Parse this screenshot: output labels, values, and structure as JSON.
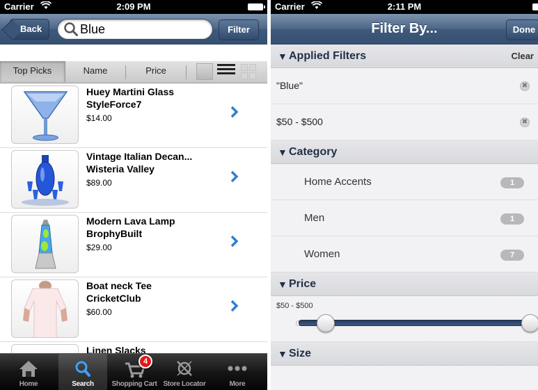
{
  "left": {
    "status": {
      "carrier": "Carrier",
      "time": "2:09 PM"
    },
    "nav": {
      "back_label": "Back",
      "search_value": "Blue",
      "filter_label": "Filter"
    },
    "sort": {
      "top_picks": "Top Picks",
      "name": "Name",
      "price": "Price"
    },
    "products": [
      {
        "name": "Huey Martini Glass",
        "brand": "StyleForce7",
        "price": "$14.00"
      },
      {
        "name": "Vintage Italian Decan...",
        "brand": "Wisteria Valley",
        "price": "$89.00"
      },
      {
        "name": "Modern Lava Lamp",
        "brand": "BrophyBuilt",
        "price": "$29.00"
      },
      {
        "name": "Boat neck Tee",
        "brand": "CricketClub",
        "price": "$60.00"
      },
      {
        "name": "Linen Slacks",
        "brand": "",
        "price": ""
      }
    ],
    "tabs": [
      {
        "label": "Home",
        "icon": "home-icon"
      },
      {
        "label": "Search",
        "icon": "search-icon"
      },
      {
        "label": "Shopping Cart",
        "icon": "cart-icon",
        "badge": "4"
      },
      {
        "label": "Store Locator",
        "icon": "compass-icon"
      },
      {
        "label": "More",
        "icon": "more-icon"
      }
    ]
  },
  "right": {
    "status": {
      "carrier": "Carrier",
      "time": "2:11 PM"
    },
    "nav": {
      "title": "Filter By...",
      "done_label": "Done"
    },
    "applied": {
      "title": "Applied Filters",
      "clear_label": "Clear",
      "items": [
        "\"Blue\"",
        "$50 - $500"
      ]
    },
    "category": {
      "title": "Category",
      "items": [
        {
          "label": "Home Accents",
          "count": "1"
        },
        {
          "label": "Men",
          "count": "1"
        },
        {
          "label": "Women",
          "count": "7"
        }
      ]
    },
    "price": {
      "title": "Price",
      "range_label": "$50 - $500"
    },
    "size": {
      "title": "Size"
    }
  },
  "colors": {
    "nav_blue": "#4d6686",
    "badge_red": "#e0191b",
    "chevron_blue": "#2f7fd1"
  }
}
